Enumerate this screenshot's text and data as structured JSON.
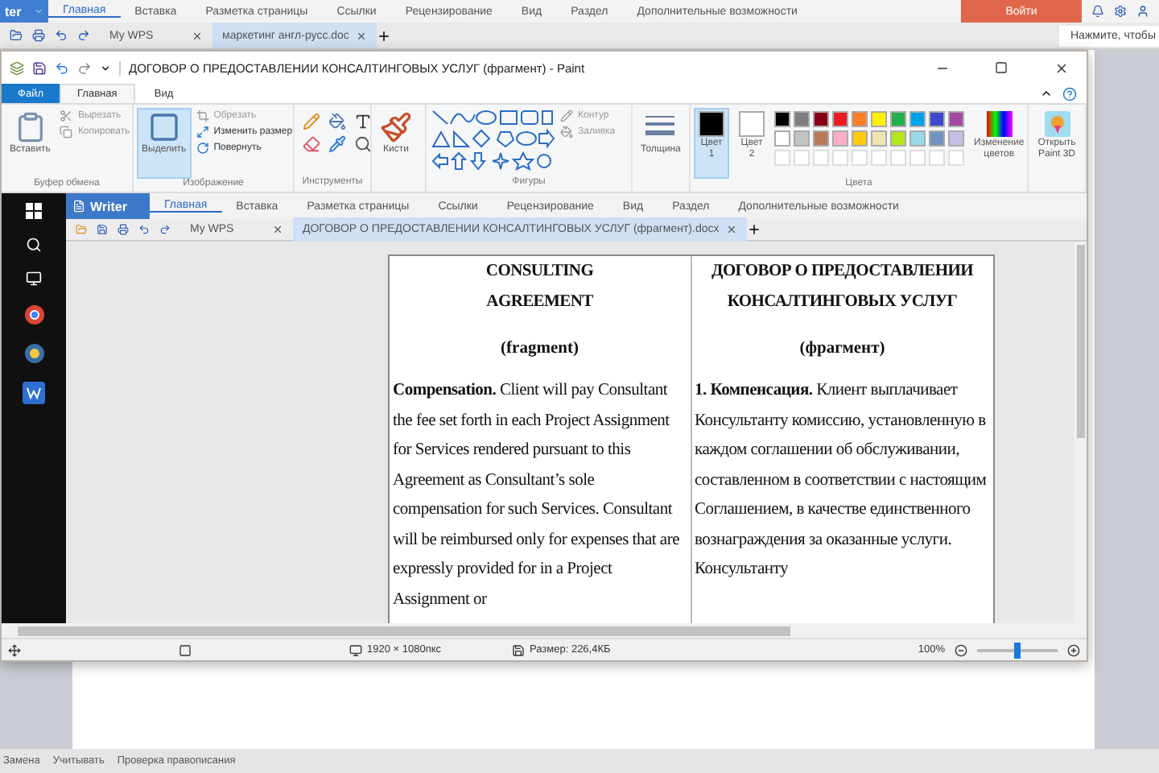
{
  "wps": {
    "app_button": "ter",
    "menu": [
      {
        "label": "Главная",
        "selected": true
      },
      {
        "label": "Вставка",
        "selected": false
      },
      {
        "label": "Разметка страницы",
        "selected": false
      },
      {
        "label": "Ссылки",
        "selected": false
      },
      {
        "label": "Рецензирование",
        "selected": false
      },
      {
        "label": "Вид",
        "selected": false
      },
      {
        "label": "Раздел",
        "selected": false
      },
      {
        "label": "Дополнительные возможности",
        "selected": false
      }
    ],
    "login": "Войти",
    "tabs": [
      {
        "label": "My WPS",
        "selected": false
      },
      {
        "label": "маркетинг англ-русс.doc",
        "selected": true
      }
    ],
    "search": {
      "placeholder": "Нажмите, чтобы"
    },
    "status_bar": [
      "Замена",
      "Учитывать",
      "Проверка правописания"
    ]
  },
  "paint": {
    "title": "ДОГОВОР О ПРЕДОСТАВЛЕНИИ КОНСАЛТИНГОВЫХ УСЛУГ (фрагмент) - Paint",
    "tabs": [
      {
        "label": "Файл",
        "kind": "file",
        "selected": false
      },
      {
        "label": "Главная",
        "kind": "tab",
        "selected": true
      },
      {
        "label": "Вид",
        "kind": "tab",
        "selected": false
      }
    ],
    "clipboard": {
      "paste": "Вставить",
      "cut": "Вырезать",
      "copy": "Копировать",
      "label": "Буфер обмена"
    },
    "image": {
      "select": "Выделить",
      "crop": "Обрезать",
      "resize": "Изменить размер",
      "rotate": "Повернуть",
      "label": "Изображение"
    },
    "tools": {
      "label": "Инструменты"
    },
    "brushes": "Кисти",
    "shapes": {
      "outline": "Контур",
      "fill": "Заливка",
      "label": "Фигуры"
    },
    "size": "Толщина",
    "colors": {
      "color1": {
        "label": "Цвет 1",
        "selected": true,
        "color": "#000000"
      },
      "color2": {
        "label": "Цвет 2",
        "selected": false,
        "color": "#ffffff"
      },
      "palette": [
        {
          "color": "#000000"
        },
        {
          "color": "#7f7f7f"
        },
        {
          "color": "#880015"
        },
        {
          "color": "#ed1c24"
        },
        {
          "color": "#ff7f27"
        },
        {
          "color": "#fff200"
        },
        {
          "color": "#22b14c"
        },
        {
          "color": "#00a2e8"
        },
        {
          "color": "#3f48cc"
        },
        {
          "color": "#a349a4"
        },
        {
          "color": "#ffffff"
        },
        {
          "color": "#c3c3c3"
        },
        {
          "color": "#b97a57"
        },
        {
          "color": "#ffaec9"
        },
        {
          "color": "#ffc90e"
        },
        {
          "color": "#efe4b0"
        },
        {
          "color": "#b5e61d"
        },
        {
          "color": "#99d9ea"
        },
        {
          "color": "#7092be"
        },
        {
          "color": "#c8bfe7"
        }
      ],
      "edit": "Изменение цветов",
      "label": "Цвета"
    },
    "paint3d": "Открыть Paint 3D",
    "status": {
      "dimensions": "1920 × 1080пкс",
      "file_size": "Размер: 226,4КБ",
      "zoom": "100%",
      "zoom_slider": {
        "level": 0.5
      }
    }
  },
  "writer": {
    "app_button": "Writer",
    "menu": [
      {
        "label": "Главная",
        "selected": true
      },
      {
        "label": "Вставка",
        "selected": false
      },
      {
        "label": "Разметка страницы",
        "selected": false
      },
      {
        "label": "Ссылки",
        "selected": false
      },
      {
        "label": "Рецензирование",
        "selected": false
      },
      {
        "label": "Вид",
        "selected": false
      },
      {
        "label": "Раздел",
        "selected": false
      },
      {
        "label": "Дополнительные возможности",
        "selected": false
      }
    ],
    "tabs": [
      {
        "label": "My WPS",
        "selected": false
      },
      {
        "label": "ДОГОВОР О ПРЕДОСТАВЛЕНИИ КОНСАЛТИНГОВЫХ УСЛУГ (фрагмент).docx",
        "selected": true
      }
    ],
    "document": {
      "columns": [
        {
          "title": "CONSULTING AGREEMENT",
          "subtitle": "(fragment)",
          "text": "**Compensation.** Client will pay Consultant the fee set forth in each Project Assignment for Services rendered pursuant to this Agreement as Consultant’s sole compensation for such Services.  Consultant will be reimbursed only for expenses that are expressly provided for in a Project Assignment or"
        },
        {
          "title": "ДОГОВОР О ПРЕДОСТАВЛЕНИИ КОНСАЛТИНГОВЫХ УСЛУГ",
          "subtitle": "(фрагмент)",
          "text": "**1. Компенсация.** Клиент выплачивает Консультанту комиссию, установленную в каждом соглашении об обслуживании, составленном в соответствии с настоящим Соглашением, в качестве единственного вознаграждения за оказанные услуги. Консультанту"
        }
      ]
    }
  }
}
